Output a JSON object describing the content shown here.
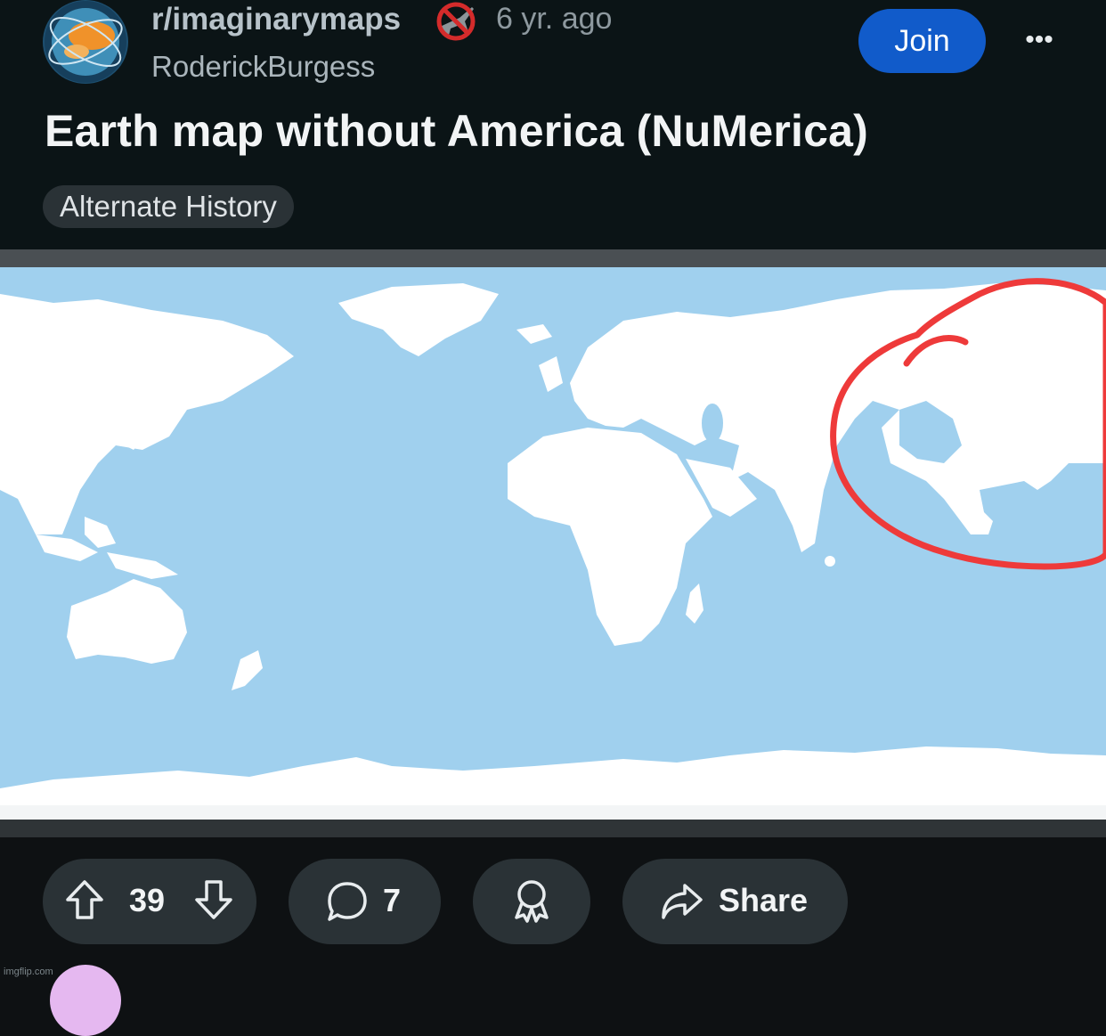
{
  "post": {
    "subreddit": "r/imaginarymaps",
    "age": "6 yr. ago",
    "author": "RoderickBurgess",
    "join_label": "Join",
    "more_label": "•••",
    "title": "Earth map without America (NuMerica)",
    "flair": "Alternate History"
  },
  "actions": {
    "votes": "39",
    "comments": "7",
    "share_label": "Share"
  },
  "watermark": "imgflip.com",
  "colors": {
    "background": "#0e1113",
    "ocean": "#a0d0ee",
    "land": "#ffffff",
    "circle": "#ee3a3a",
    "join": "#115bca",
    "pill": "#2a3236"
  },
  "icons": [
    "subreddit-avatar",
    "no-plane-icon",
    "more-icon",
    "upvote-icon",
    "downvote-icon",
    "comment-icon",
    "award-icon",
    "share-icon"
  ]
}
